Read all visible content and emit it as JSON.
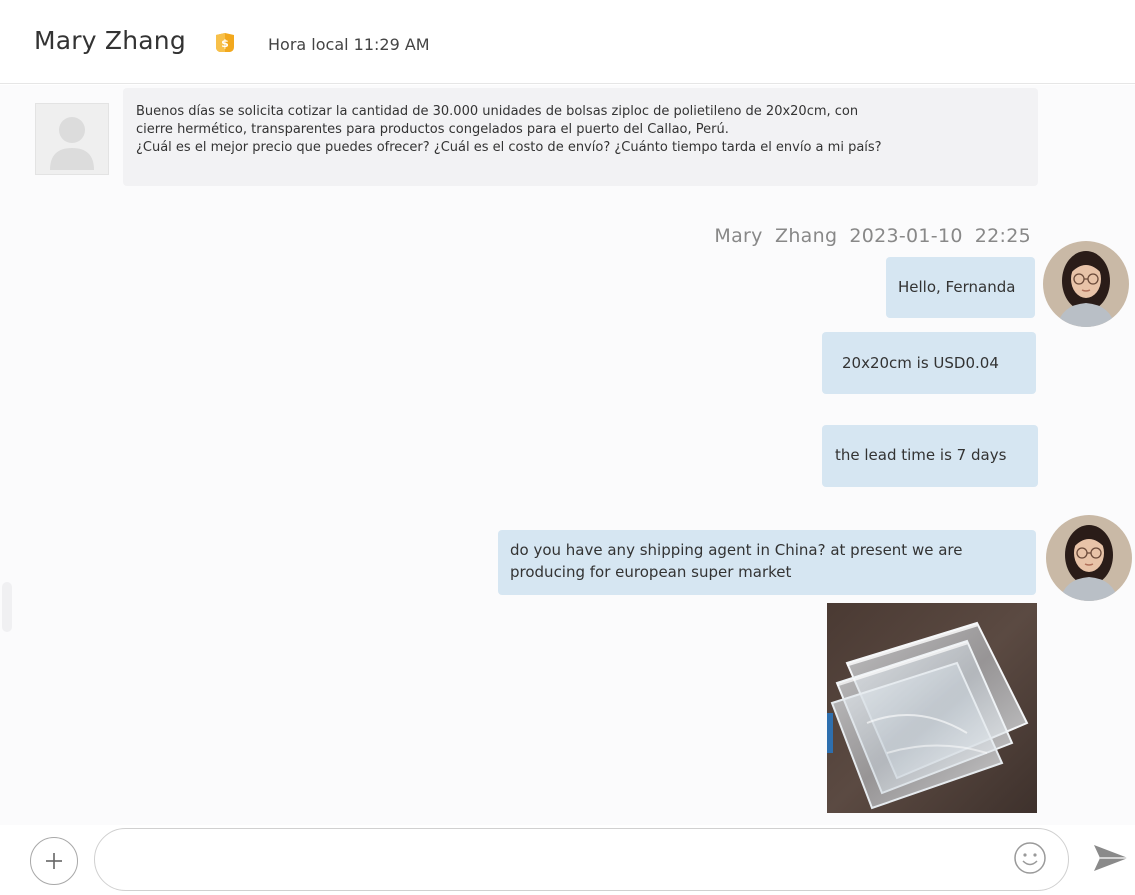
{
  "header": {
    "contact_name": "Mary Zhang",
    "local_time": "Hora local 11:29 AM"
  },
  "messages": {
    "incoming": {
      "lines": [
        "Buenos días se solicita cotizar la cantidad de 30.000 unidades de bolsas ziploc de polietileno  de 20x20cm, con",
        "cierre hermético, transparentes para productos congelados para el puerto del Callao, Perú.",
        "¿Cuál es el mejor precio que puedes ofrecer? ¿Cuál es el costo de envío? ¿Cuánto tiempo tarda el envío a mi país?"
      ]
    },
    "sender": {
      "name": "Mary Zhang",
      "date": "2023-01-10",
      "time": "22:25"
    },
    "outgoing": [
      {
        "text": "Hello, Fernanda"
      },
      {
        "text": "20x20cm is USD0.04"
      },
      {
        "text": "the lead time is 7 days"
      },
      {
        "lines": [
          "do you have any shipping agent in China? at present we are",
          "producing for european super market"
        ]
      }
    ]
  },
  "composer": {
    "placeholder": "",
    "icons": [
      "plus-icon",
      "smiley-icon",
      "send-icon"
    ]
  },
  "colors": {
    "outgoing_bubble": "#d6e6f2",
    "incoming_bubble": "#f2f2f4",
    "badge": "#f2a81d",
    "timestamp": "#888888"
  }
}
